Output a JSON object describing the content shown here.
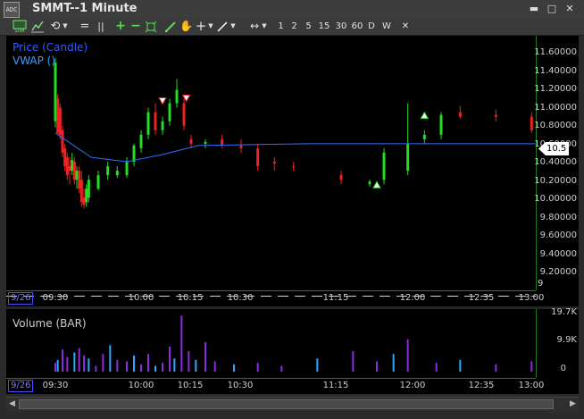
{
  "window": {
    "title": "SMMT--1 Minute",
    "logo_text": "ADC",
    "minimize": "▬",
    "maximize": "□",
    "close": "✕"
  },
  "toolbar": {
    "intervals": [
      "1",
      "2",
      "5",
      "15",
      "30",
      "60",
      "D",
      "W"
    ],
    "close_label": "✕"
  },
  "price_pane": {
    "legend_price": "Price (Candle)",
    "legend_vwap": "VWAP ()",
    "y_ticks": [
      "11.60000",
      "11.40000",
      "11.20000",
      "11.00000",
      "10.80000",
      "10.60000",
      "10.40000",
      "10.20000",
      "10.00000",
      "9.80000",
      "9.60000",
      "9.40000",
      "9.20000",
      "9"
    ],
    "last_price": "10.5",
    "date_label": "9/26",
    "x_ticks": [
      "09:30",
      "10:00",
      "10:15",
      "10:30",
      "11:15",
      "12:00",
      "12:35",
      "13:00"
    ]
  },
  "volume_pane": {
    "legend": "Volume (BAR)",
    "y_ticks": [
      "19.7K",
      "9.9K",
      "0"
    ],
    "date_label": "9/26",
    "x_ticks": [
      "09:30",
      "10:00",
      "10:15",
      "10:30",
      "11:15",
      "12:00",
      "12:35",
      "13:00"
    ]
  },
  "colors": {
    "up": "#22dd22",
    "down": "#ee2222",
    "vwap": "#2f6fff",
    "volume_purple": "#8a2be2",
    "volume_blue": "#2aa7ff",
    "axis_green": "#1f7a1f",
    "background": "#000000"
  },
  "chart_data": {
    "type": "candlestick",
    "symbol": "SMMT",
    "interval": "1 Minute",
    "ylim": [
      9.0,
      11.7
    ],
    "volume_ylim": [
      0,
      19700
    ],
    "x_range": [
      "09:21",
      "13:05"
    ],
    "candles": [
      {
        "t": "09:30",
        "o": 10.75,
        "h": 11.45,
        "l": 10.68,
        "c": 11.4
      },
      {
        "t": "09:31",
        "o": 11.0,
        "h": 11.05,
        "l": 10.6,
        "c": 10.62
      },
      {
        "t": "09:32",
        "o": 10.9,
        "h": 10.95,
        "l": 10.55,
        "c": 10.6
      },
      {
        "t": "09:33",
        "o": 10.65,
        "h": 10.7,
        "l": 10.35,
        "c": 10.4
      },
      {
        "t": "09:34",
        "o": 10.45,
        "h": 10.5,
        "l": 10.2,
        "c": 10.25
      },
      {
        "t": "09:35",
        "o": 10.35,
        "h": 10.4,
        "l": 10.1,
        "c": 10.15
      },
      {
        "t": "09:36",
        "o": 10.25,
        "h": 10.35,
        "l": 10.05,
        "c": 10.2
      },
      {
        "t": "09:37",
        "o": 10.2,
        "h": 10.4,
        "l": 10.15,
        "c": 10.32
      },
      {
        "t": "09:38",
        "o": 10.3,
        "h": 10.35,
        "l": 10.05,
        "c": 10.1
      },
      {
        "t": "09:39",
        "o": 10.1,
        "h": 10.25,
        "l": 10.0,
        "c": 10.2
      },
      {
        "t": "09:40",
        "o": 10.2,
        "h": 10.25,
        "l": 9.95,
        "c": 10.0
      },
      {
        "t": "09:41",
        "o": 10.1,
        "h": 10.2,
        "l": 9.8,
        "c": 9.85
      },
      {
        "t": "09:42",
        "o": 9.9,
        "h": 10.0,
        "l": 9.78,
        "c": 9.82
      },
      {
        "t": "09:43",
        "o": 9.85,
        "h": 10.05,
        "l": 9.8,
        "c": 10.0
      },
      {
        "t": "09:44",
        "o": 9.9,
        "h": 10.15,
        "l": 9.85,
        "c": 10.1
      },
      {
        "t": "09:48",
        "o": 10.0,
        "h": 10.2,
        "l": 9.98,
        "c": 10.15
      },
      {
        "t": "09:52",
        "o": 10.15,
        "h": 10.3,
        "l": 10.1,
        "c": 10.25
      },
      {
        "t": "09:56",
        "o": 10.15,
        "h": 10.25,
        "l": 10.12,
        "c": 10.2
      },
      {
        "t": "10:00",
        "o": 10.15,
        "h": 10.35,
        "l": 10.12,
        "c": 10.3
      },
      {
        "t": "10:03",
        "o": 10.3,
        "h": 10.5,
        "l": 10.25,
        "c": 10.48
      },
      {
        "t": "10:06",
        "o": 10.45,
        "h": 10.65,
        "l": 10.4,
        "c": 10.6
      },
      {
        "t": "10:09",
        "o": 10.6,
        "h": 10.9,
        "l": 10.55,
        "c": 10.85
      },
      {
        "t": "10:12",
        "o": 10.85,
        "h": 10.95,
        "l": 10.6,
        "c": 10.65
      },
      {
        "t": "10:15",
        "o": 10.65,
        "h": 10.8,
        "l": 10.6,
        "c": 10.75
      },
      {
        "t": "10:18",
        "o": 10.75,
        "h": 11.0,
        "l": 10.7,
        "c": 10.95
      },
      {
        "t": "10:21",
        "o": 10.95,
        "h": 11.22,
        "l": 10.9,
        "c": 11.1
      },
      {
        "t": "10:24",
        "o": 10.95,
        "h": 11.0,
        "l": 10.65,
        "c": 10.7
      },
      {
        "t": "10:27",
        "o": 10.55,
        "h": 10.6,
        "l": 10.45,
        "c": 10.5
      },
      {
        "t": "10:33",
        "o": 10.5,
        "h": 10.55,
        "l": 10.45,
        "c": 10.52
      },
      {
        "t": "10:40",
        "o": 10.55,
        "h": 10.6,
        "l": 10.45,
        "c": 10.48
      },
      {
        "t": "10:48",
        "o": 10.48,
        "h": 10.55,
        "l": 10.4,
        "c": 10.45
      },
      {
        "t": "10:55",
        "o": 10.45,
        "h": 10.5,
        "l": 10.2,
        "c": 10.25
      },
      {
        "t": "11:02",
        "o": 10.3,
        "h": 10.35,
        "l": 10.2,
        "c": 10.28
      },
      {
        "t": "11:10",
        "o": 10.25,
        "h": 10.3,
        "l": 10.2,
        "c": 10.24
      },
      {
        "t": "11:30",
        "o": 10.15,
        "h": 10.2,
        "l": 10.05,
        "c": 10.1
      },
      {
        "t": "11:42",
        "o": 10.05,
        "h": 10.1,
        "l": 10.02,
        "c": 10.08
      },
      {
        "t": "11:48",
        "o": 10.1,
        "h": 10.45,
        "l": 10.05,
        "c": 10.4
      },
      {
        "t": "11:58",
        "o": 10.2,
        "h": 10.95,
        "l": 10.15,
        "c": 10.5
      },
      {
        "t": "12:05",
        "o": 10.55,
        "h": 10.65,
        "l": 10.5,
        "c": 10.6
      },
      {
        "t": "12:12",
        "o": 10.6,
        "h": 10.85,
        "l": 10.55,
        "c": 10.82
      },
      {
        "t": "12:20",
        "o": 10.85,
        "h": 10.92,
        "l": 10.78,
        "c": 10.8
      },
      {
        "t": "12:35",
        "o": 10.82,
        "h": 10.88,
        "l": 10.75,
        "c": 10.8
      },
      {
        "t": "12:50",
        "o": 10.8,
        "h": 10.85,
        "l": 10.62,
        "c": 10.65
      },
      {
        "t": "12:58",
        "o": 10.5,
        "h": 10.6,
        "l": 10.45,
        "c": 10.55
      }
    ],
    "vwap": [
      {
        "t": "09:30",
        "v": 10.62
      },
      {
        "t": "09:45",
        "v": 10.35
      },
      {
        "t": "10:00",
        "v": 10.3
      },
      {
        "t": "10:15",
        "v": 10.38
      },
      {
        "t": "10:30",
        "v": 10.48
      },
      {
        "t": "11:15",
        "v": 10.5
      },
      {
        "t": "12:00",
        "v": 10.5
      },
      {
        "t": "12:35",
        "v": 10.5
      },
      {
        "t": "13:00",
        "v": 10.5
      }
    ],
    "signals": [
      {
        "t": "10:15",
        "price": 10.97,
        "kind": "sell"
      },
      {
        "t": "10:25",
        "price": 11.0,
        "kind": "sell"
      },
      {
        "t": "11:45",
        "price": 10.05,
        "kind": "buy"
      },
      {
        "t": "12:05",
        "price": 10.82,
        "kind": "buy"
      }
    ],
    "volume": [
      {
        "t": "09:30",
        "v": 3000
      },
      {
        "t": "09:31",
        "v": 4000
      },
      {
        "t": "09:33",
        "v": 7500
      },
      {
        "t": "09:35",
        "v": 5000
      },
      {
        "t": "09:38",
        "v": 6500
      },
      {
        "t": "09:40",
        "v": 8000
      },
      {
        "t": "09:42",
        "v": 5500
      },
      {
        "t": "09:44",
        "v": 4500
      },
      {
        "t": "09:47",
        "v": 2000
      },
      {
        "t": "09:50",
        "v": 6000
      },
      {
        "t": "09:53",
        "v": 9000
      },
      {
        "t": "09:56",
        "v": 4000
      },
      {
        "t": "10:00",
        "v": 3500
      },
      {
        "t": "10:03",
        "v": 5500
      },
      {
        "t": "10:06",
        "v": 2500
      },
      {
        "t": "10:09",
        "v": 6000
      },
      {
        "t": "10:12",
        "v": 2000
      },
      {
        "t": "10:15",
        "v": 3000
      },
      {
        "t": "10:18",
        "v": 8500
      },
      {
        "t": "10:20",
        "v": 4500
      },
      {
        "t": "10:23",
        "v": 19000
      },
      {
        "t": "10:26",
        "v": 7000
      },
      {
        "t": "10:29",
        "v": 4000
      },
      {
        "t": "10:33",
        "v": 10000
      },
      {
        "t": "10:37",
        "v": 3500
      },
      {
        "t": "10:45",
        "v": 2500
      },
      {
        "t": "10:55",
        "v": 3000
      },
      {
        "t": "11:05",
        "v": 2000
      },
      {
        "t": "11:20",
        "v": 4500
      },
      {
        "t": "11:35",
        "v": 7000
      },
      {
        "t": "11:45",
        "v": 3500
      },
      {
        "t": "11:52",
        "v": 6000
      },
      {
        "t": "11:58",
        "v": 11000
      },
      {
        "t": "12:10",
        "v": 3000
      },
      {
        "t": "12:20",
        "v": 4000
      },
      {
        "t": "12:35",
        "v": 2500
      },
      {
        "t": "12:50",
        "v": 3500
      },
      {
        "t": "12:58",
        "v": 6000
      }
    ]
  }
}
